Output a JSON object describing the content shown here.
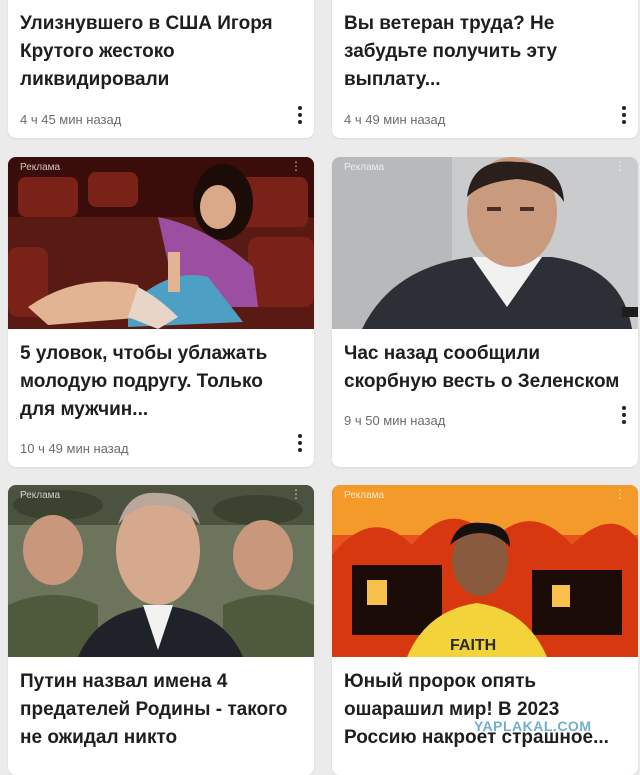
{
  "cards": [
    {
      "title": "Улизнувшего в США Игоря Крутого жестоко ликвидировали",
      "time": "4 ч 45 мин назад",
      "ad": ""
    },
    {
      "title": "Вы ветеран труда? Не забудьте получить эту выплату...",
      "time": "4 ч 49 мин назад",
      "ad": ""
    },
    {
      "title": "5 уловок, чтобы ублажать молодую подругу. Только для мужчин...",
      "time": "10 ч 49 мин назад",
      "ad": "Реклама"
    },
    {
      "title": "Час назад сообщили скорбную весть о Зеленском",
      "time": "9 ч 50 мин назад",
      "ad": "Реклама"
    },
    {
      "title": "Путин назвал имена 4 предателей Родины - такого не ожидал никто",
      "time": "",
      "ad": "Реклама"
    },
    {
      "title": "Юный пророк опять ошарашил мир! В 2023 Россию накроет страшное...",
      "time": "",
      "ad": "Реклама"
    }
  ],
  "image_texts": {
    "shirt": "FAITH"
  },
  "watermark": "YAPLAKAL.COM"
}
